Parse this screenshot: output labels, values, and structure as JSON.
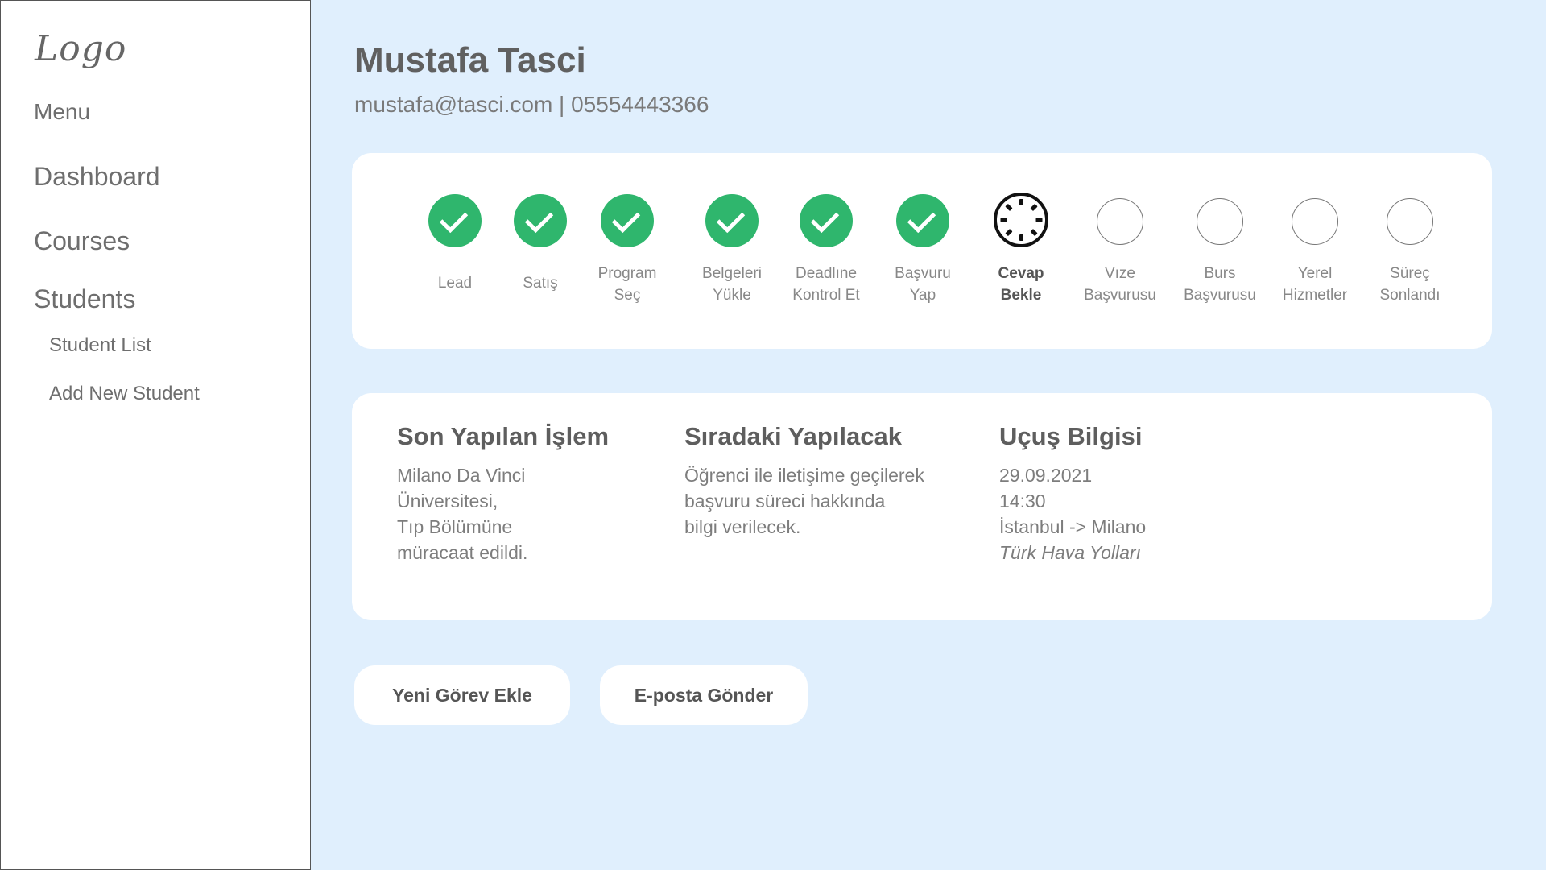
{
  "sidebar": {
    "logo": "Logo",
    "menu_label": "Menu",
    "items": {
      "dashboard": "Dashboard",
      "courses": "Courses",
      "students": "Students",
      "student_list": "Student List",
      "add_new_student": "Add New Student"
    }
  },
  "profile": {
    "name": "Mustafa Tasci",
    "contact": "mustafa@tasci.com | 05554443366"
  },
  "steps": [
    {
      "line1": "Lead",
      "line2": "",
      "status": "done"
    },
    {
      "line1": "Satış",
      "line2": "",
      "status": "done"
    },
    {
      "line1": "Program",
      "line2": "Seç",
      "status": "done"
    },
    {
      "line1": "Belgeleri",
      "line2": "Yükle",
      "status": "done"
    },
    {
      "line1": "Deadlıne",
      "line2": "Kontrol Et",
      "status": "done"
    },
    {
      "line1": "Başvuru",
      "line2": "Yap",
      "status": "done"
    },
    {
      "line1": "Cevap",
      "line2": "Bekle",
      "status": "current"
    },
    {
      "line1": "Vıze",
      "line2": "Başvurusu",
      "status": "pending"
    },
    {
      "line1": "Burs",
      "line2": "Başvurusu",
      "status": "pending"
    },
    {
      "line1": "Yerel",
      "line2": "Hizmetler",
      "status": "pending"
    },
    {
      "line1": "Süreç",
      "line2": "Sonlandı",
      "status": "pending"
    }
  ],
  "status_colors": {
    "done": "#2fb66d",
    "current": "#111111",
    "pending": "#777777"
  },
  "info": {
    "last_action": {
      "title": "Son Yapılan İşlem",
      "lines": [
        "Milano Da Vinci",
        "Üniversitesi,",
        "Tıp Bölümüne",
        "müracaat edildi."
      ]
    },
    "next_action": {
      "title": "Sıradaki Yapılacak",
      "lines": [
        "Öğrenci ile iletişime geçilerek",
        "başvuru süreci hakkında",
        "bilgi verilecek."
      ]
    },
    "flight": {
      "title": "Uçuş Bilgisi",
      "lines": [
        "29.09.2021",
        "14:30",
        "İstanbul -> Milano",
        "Türk Hava Yolları"
      ]
    }
  },
  "actions": {
    "add_task": "Yeni Görev Ekle",
    "send_email": "E-posta Gönder"
  }
}
